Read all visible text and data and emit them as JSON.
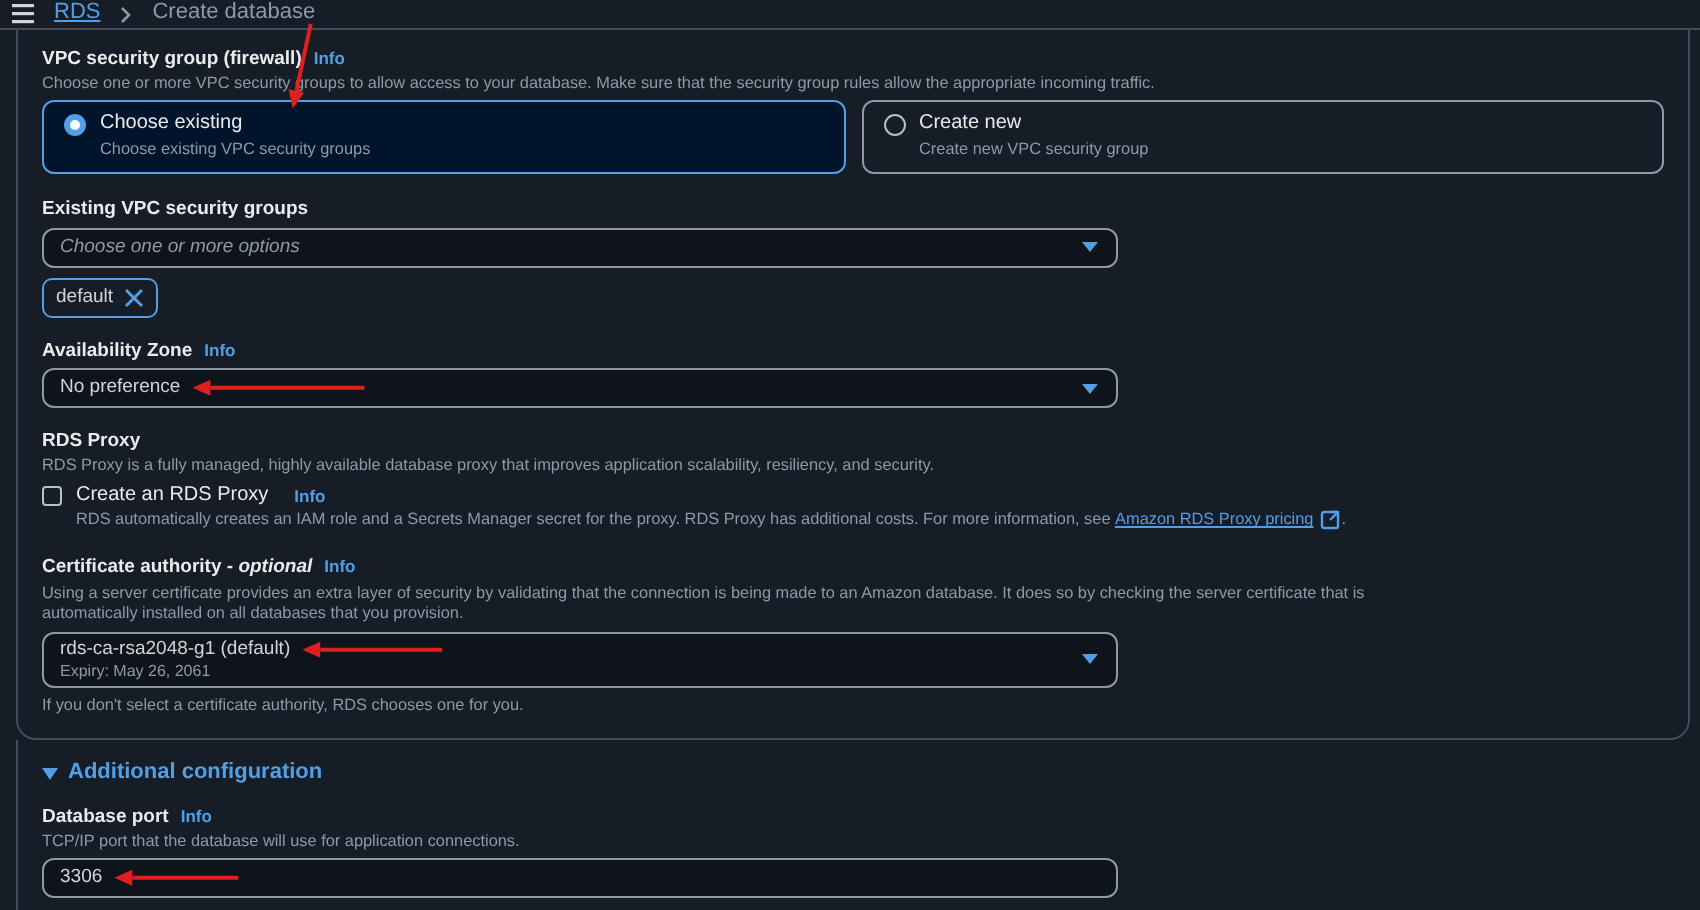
{
  "breadcrumb": [
    {
      "label": "RDS",
      "kind": "link"
    },
    {
      "label": "Create database",
      "kind": "current"
    }
  ],
  "vpc_security_group": {
    "label": "VPC security group (firewall)",
    "info": "Info",
    "description": "Choose one or more VPC security groups to allow access to your database. Make sure that the security group rules allow the appropriate incoming traffic.",
    "options": [
      {
        "title": "Choose existing",
        "description": "Choose existing VPC security groups",
        "selected": true
      },
      {
        "title": "Create new",
        "description": "Create new VPC security group",
        "selected": false
      }
    ]
  },
  "existing_vpc_security_groups": {
    "label": "Existing VPC security groups",
    "placeholder": "Choose one or more options",
    "tokens": [
      {
        "label": "default"
      }
    ]
  },
  "availability_zone": {
    "label": "Availability Zone",
    "info": "Info",
    "value": "No preference"
  },
  "rds_proxy": {
    "label": "RDS Proxy",
    "description": "RDS Proxy is a fully managed, highly available database proxy that improves application scalability, resiliency, and security.",
    "checkbox": {
      "label": "Create an RDS Proxy",
      "info": "Info",
      "checked": false,
      "description": "RDS automatically creates an IAM role and a Secrets Manager secret for the proxy. RDS Proxy has additional costs. For more information, see",
      "link": "Amazon RDS Proxy pricing",
      "description_end": "."
    }
  },
  "certificate_authority": {
    "label": "Certificate authority - *optional*",
    "info": "Info",
    "description": "Using a server certificate provides an extra layer of security by validating that the connection is being made to an Amazon database. It does so by checking the server certificate that is automatically installed on all databases that you provision.",
    "value": "rds-ca-rsa2048-g1 (default)",
    "detail": "Expiry: May 26, 2061",
    "hint": "If you don't select a certificate authority, RDS chooses one for you."
  },
  "additional_configuration": {
    "title": "Additional configuration",
    "expanded": true,
    "database_port": {
      "label": "Database port",
      "info": "Info",
      "description": "TCP/IP port that the database will use for application connections.",
      "value": "3306"
    }
  }
}
